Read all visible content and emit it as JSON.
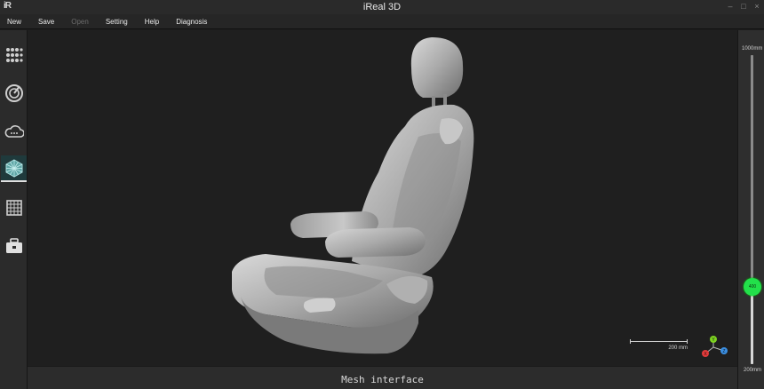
{
  "window": {
    "logo": "iR",
    "title": "iReal 3D",
    "controls": [
      "–",
      "□",
      "×"
    ]
  },
  "menu": [
    {
      "label": "New",
      "enabled": true
    },
    {
      "label": "Save",
      "enabled": true
    },
    {
      "label": "Open",
      "enabled": false
    },
    {
      "label": "Setting",
      "enabled": true
    },
    {
      "label": "Help",
      "enabled": true
    },
    {
      "label": "Diagnosis",
      "enabled": true
    }
  ],
  "sidebar": {
    "items": [
      {
        "icon": "dot-grid-icon",
        "active": false
      },
      {
        "icon": "scan-target-icon",
        "active": false
      },
      {
        "icon": "point-cloud-icon",
        "active": false
      },
      {
        "icon": "mesh-cube-icon",
        "active": true
      },
      {
        "icon": "texture-grid-icon",
        "active": false
      },
      {
        "icon": "toolbox-icon",
        "active": false
      }
    ]
  },
  "viewport": {
    "model": "car-seat-mesh",
    "scale_bar_label": "200 mm",
    "axes": {
      "y": "Y",
      "x": "X",
      "z": "Z"
    },
    "colors": {
      "x": "#e23b3b",
      "y": "#7ed321",
      "z": "#3b8fe2"
    }
  },
  "footer": {
    "label": "Mesh interface"
  },
  "depth_slider": {
    "max_label": "1000mm",
    "min_label": "200mm",
    "handle_label": "400",
    "level_fraction": 0.25,
    "handle_color": "#22e04a"
  }
}
